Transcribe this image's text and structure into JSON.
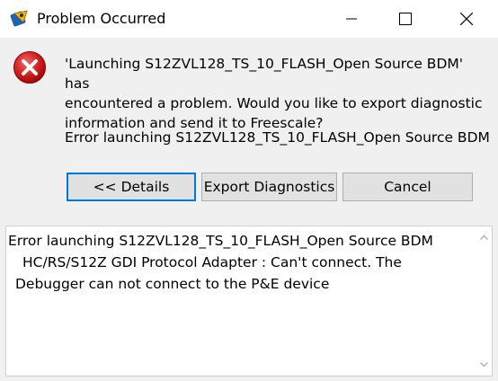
{
  "window": {
    "title": "Problem Occurred",
    "icon": "pb-bug-icon"
  },
  "message": {
    "lines": [
      "'Launching S12ZVL128_TS_10_FLASH_Open Source BDM' has",
      "encountered a problem. Would you like to export diagnostic",
      "information and send it to Freescale?"
    ],
    "error_summary": "Error launching S12ZVL128_TS_10_FLASH_Open Source BDM"
  },
  "buttons": {
    "details_label": "<< Details",
    "export_label": "Export Diagnostics",
    "cancel_label": "Cancel"
  },
  "details": {
    "lines": [
      "Error launching S12ZVL128_TS_10_FLASH_Open Source BDM",
      "HC/RS/S12Z GDI Protocol Adapter : Can't connect. The",
      "Debugger can not connect to the P&E device"
    ]
  },
  "colors": {
    "accent": "#0078d7",
    "error_red": "#c8102e"
  }
}
